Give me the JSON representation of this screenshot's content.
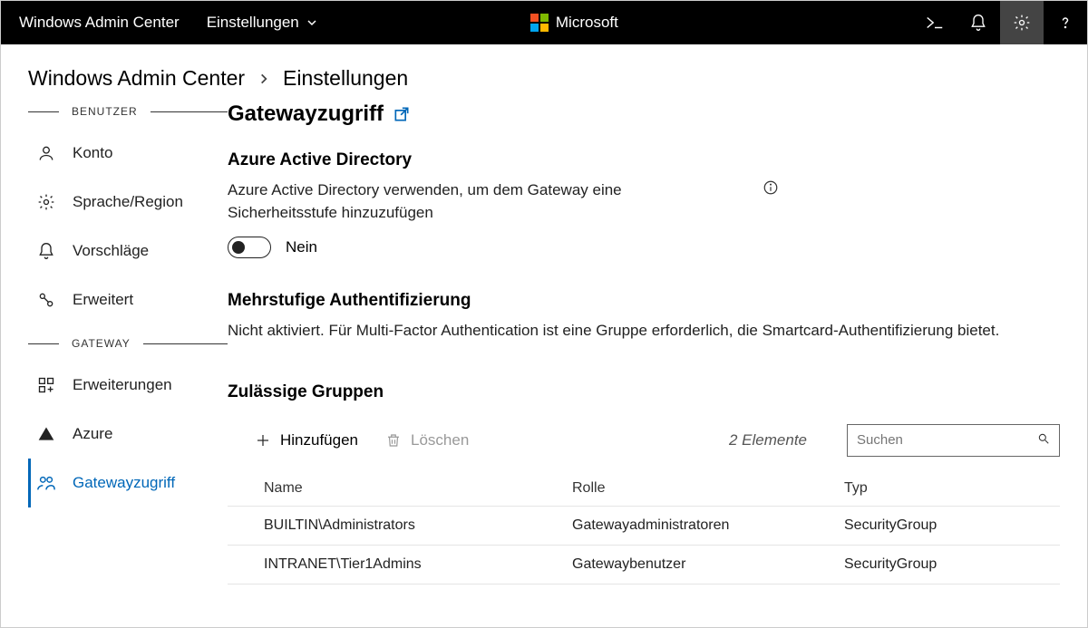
{
  "topbar": {
    "app_title": "Windows Admin Center",
    "dropdown_label": "Einstellungen",
    "brand": "Microsoft"
  },
  "breadcrumb": {
    "root": "Windows Admin Center",
    "current": "Einstellungen"
  },
  "sidebar": {
    "section_user": "BENUTZER",
    "section_gateway": "GATEWAY",
    "items_user": [
      {
        "label": "Konto",
        "icon": "person-icon"
      },
      {
        "label": "Sprache/Region",
        "icon": "gear-icon"
      },
      {
        "label": "Vorschläge",
        "icon": "bell-icon"
      },
      {
        "label": "Erweitert",
        "icon": "wrench-gear-icon"
      }
    ],
    "items_gateway": [
      {
        "label": "Erweiterungen",
        "icon": "extensions-icon"
      },
      {
        "label": "Azure",
        "icon": "azure-icon"
      },
      {
        "label": "Gatewayzugriff",
        "icon": "people-key-icon",
        "active": true
      }
    ]
  },
  "content": {
    "title": "Gatewayzugriff",
    "aad": {
      "heading": "Azure Active Directory",
      "desc": "Azure Active Directory verwenden, um dem Gateway eine Sicherheitsstufe hinzuzufügen",
      "toggle_state": "Nein"
    },
    "mfa": {
      "heading": "Mehrstufige Authentifizierung",
      "desc": "Nicht aktiviert. Für Multi-Factor Authentication ist eine Gruppe erforderlich, die Smartcard-Authentifizierung bietet."
    },
    "groups": {
      "heading": "Zulässige Gruppen",
      "add_label": "Hinzufügen",
      "delete_label": "Löschen",
      "count_label": "2 Elemente",
      "search_placeholder": "Suchen",
      "columns": {
        "name": "Name",
        "role": "Rolle",
        "type": "Typ"
      },
      "rows": [
        {
          "name": "BUILTIN\\Administrators",
          "role": "Gatewayadministratoren",
          "type": "SecurityGroup"
        },
        {
          "name": "INTRANET\\Tier1Admins",
          "role": "Gatewaybenutzer",
          "type": "SecurityGroup"
        }
      ]
    }
  }
}
